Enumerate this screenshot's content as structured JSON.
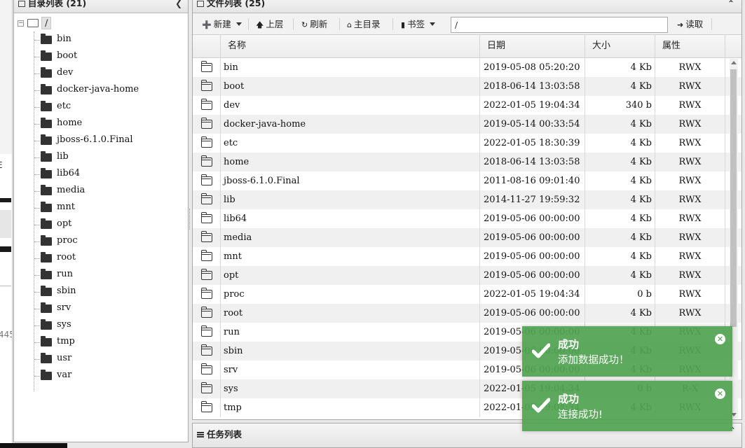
{
  "left_panel": {
    "title": "目录列表 (21)",
    "collapse_icon": "chevron-left-icon",
    "root_toggle": "−",
    "root_label": "/",
    "dirs": [
      "bin",
      "boot",
      "dev",
      "docker-java-home",
      "etc",
      "home",
      "jboss-6.1.0.Final",
      "lib",
      "lib64",
      "media",
      "mnt",
      "opt",
      "proc",
      "root",
      "run",
      "sbin",
      "srv",
      "sys",
      "tmp",
      "usr",
      "var"
    ]
  },
  "right_panel": {
    "title": "文件列表 (25)",
    "collapse_icon": "chevron-up-icon",
    "toolbar": {
      "new_label": "新建",
      "up_label": "上层",
      "refresh_label": "刷新",
      "home_label": "主目录",
      "bookmark_label": "书签",
      "path_value": "/",
      "read_label": "读取"
    },
    "columns": {
      "name": "名称",
      "date": "日期",
      "size": "大小",
      "attr": "属性"
    },
    "rows": [
      {
        "name": "bin",
        "date": "2019-05-08 05:20:20",
        "size": "4 Kb",
        "attr": "RWX"
      },
      {
        "name": "boot",
        "date": "2018-06-14 13:03:58",
        "size": "4 Kb",
        "attr": "RWX"
      },
      {
        "name": "dev",
        "date": "2022-01-05 19:04:34",
        "size": "340 b",
        "attr": "RWX"
      },
      {
        "name": "docker-java-home",
        "date": "2019-05-14 00:33:54",
        "size": "4 Kb",
        "attr": "RWX"
      },
      {
        "name": "etc",
        "date": "2022-01-05 18:30:39",
        "size": "4 Kb",
        "attr": "RWX"
      },
      {
        "name": "home",
        "date": "2018-06-14 13:03:58",
        "size": "4 Kb",
        "attr": "RWX"
      },
      {
        "name": "jboss-6.1.0.Final",
        "date": "2011-08-16 09:01:40",
        "size": "4 Kb",
        "attr": "RWX"
      },
      {
        "name": "lib",
        "date": "2014-11-27 19:59:32",
        "size": "4 Kb",
        "attr": "RWX"
      },
      {
        "name": "lib64",
        "date": "2019-05-06 00:00:00",
        "size": "4 Kb",
        "attr": "RWX"
      },
      {
        "name": "media",
        "date": "2019-05-06 00:00:00",
        "size": "4 Kb",
        "attr": "RWX"
      },
      {
        "name": "mnt",
        "date": "2019-05-06 00:00:00",
        "size": "4 Kb",
        "attr": "RWX"
      },
      {
        "name": "opt",
        "date": "2019-05-06 00:00:00",
        "size": "4 Kb",
        "attr": "RWX"
      },
      {
        "name": "proc",
        "date": "2022-01-05 19:04:34",
        "size": "0 b",
        "attr": "RWX"
      },
      {
        "name": "root",
        "date": "2019-05-06 00:00:00",
        "size": "4 Kb",
        "attr": "RWX"
      },
      {
        "name": "run",
        "date": "2019-05-06 00:00:00",
        "size": "4 Kb",
        "attr": "RWX"
      },
      {
        "name": "sbin",
        "date": "2019-05-06 00:00:00",
        "size": "4 Kb",
        "attr": "RWX"
      },
      {
        "name": "srv",
        "date": "2019-05-06 00:00:00",
        "size": "4 Kb",
        "attr": "RWX"
      },
      {
        "name": "sys",
        "date": "2022-01-05 19:04:34",
        "size": "0 b",
        "attr": "R-X"
      },
      {
        "name": "tmp",
        "date": "2022-01-05 19:04:34",
        "size": "4 Kb",
        "attr": "RWX"
      }
    ]
  },
  "task_panel": {
    "title": "任务列表"
  },
  "toasts": [
    {
      "title": "成功",
      "message": "添加数据成功！",
      "color": "#51a351"
    },
    {
      "title": "成功",
      "message": "连接成功!",
      "color": "#51a351"
    }
  ],
  "background_edge": {
    "text": "E",
    "number": "445"
  }
}
